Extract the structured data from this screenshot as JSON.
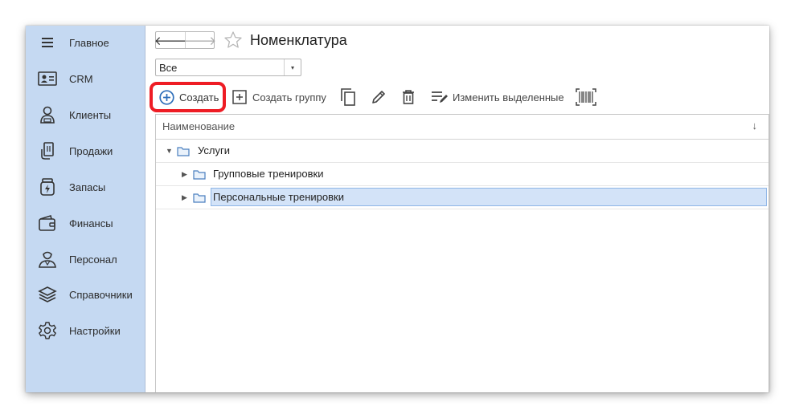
{
  "sidebar": {
    "items": [
      {
        "label": "Главное",
        "icon": "menu-icon"
      },
      {
        "label": "CRM",
        "icon": "contact-card-icon"
      },
      {
        "label": "Клиенты",
        "icon": "client-icon"
      },
      {
        "label": "Продажи",
        "icon": "sales-icon"
      },
      {
        "label": "Запасы",
        "icon": "stock-jar-icon"
      },
      {
        "label": "Финансы",
        "icon": "wallet-icon"
      },
      {
        "label": "Персонал",
        "icon": "staff-icon"
      },
      {
        "label": "Справочники",
        "icon": "books-icon"
      },
      {
        "label": "Настройки",
        "icon": "gear-icon"
      }
    ]
  },
  "header": {
    "title": "Номенклатура"
  },
  "filter": {
    "value": "Все"
  },
  "toolbar": {
    "create_label": "Создать",
    "create_group_label": "Создать группу",
    "edit_selected_label": "Изменить выделенные"
  },
  "grid": {
    "column_name": "Наименование",
    "sort_indicator": "↓",
    "rows": [
      {
        "label": "Услуги",
        "level": 0,
        "expanded": true
      },
      {
        "label": "Групповые тренировки",
        "level": 1,
        "expanded": false
      },
      {
        "label": "Персональные тренировки",
        "level": 1,
        "expanded": false,
        "selected": true
      }
    ]
  },
  "colors": {
    "sidebar_bg": "#c5d9f2",
    "accent": "#2f6fba",
    "highlight_red": "#ee1c24",
    "selection": "#d3e3f8"
  }
}
